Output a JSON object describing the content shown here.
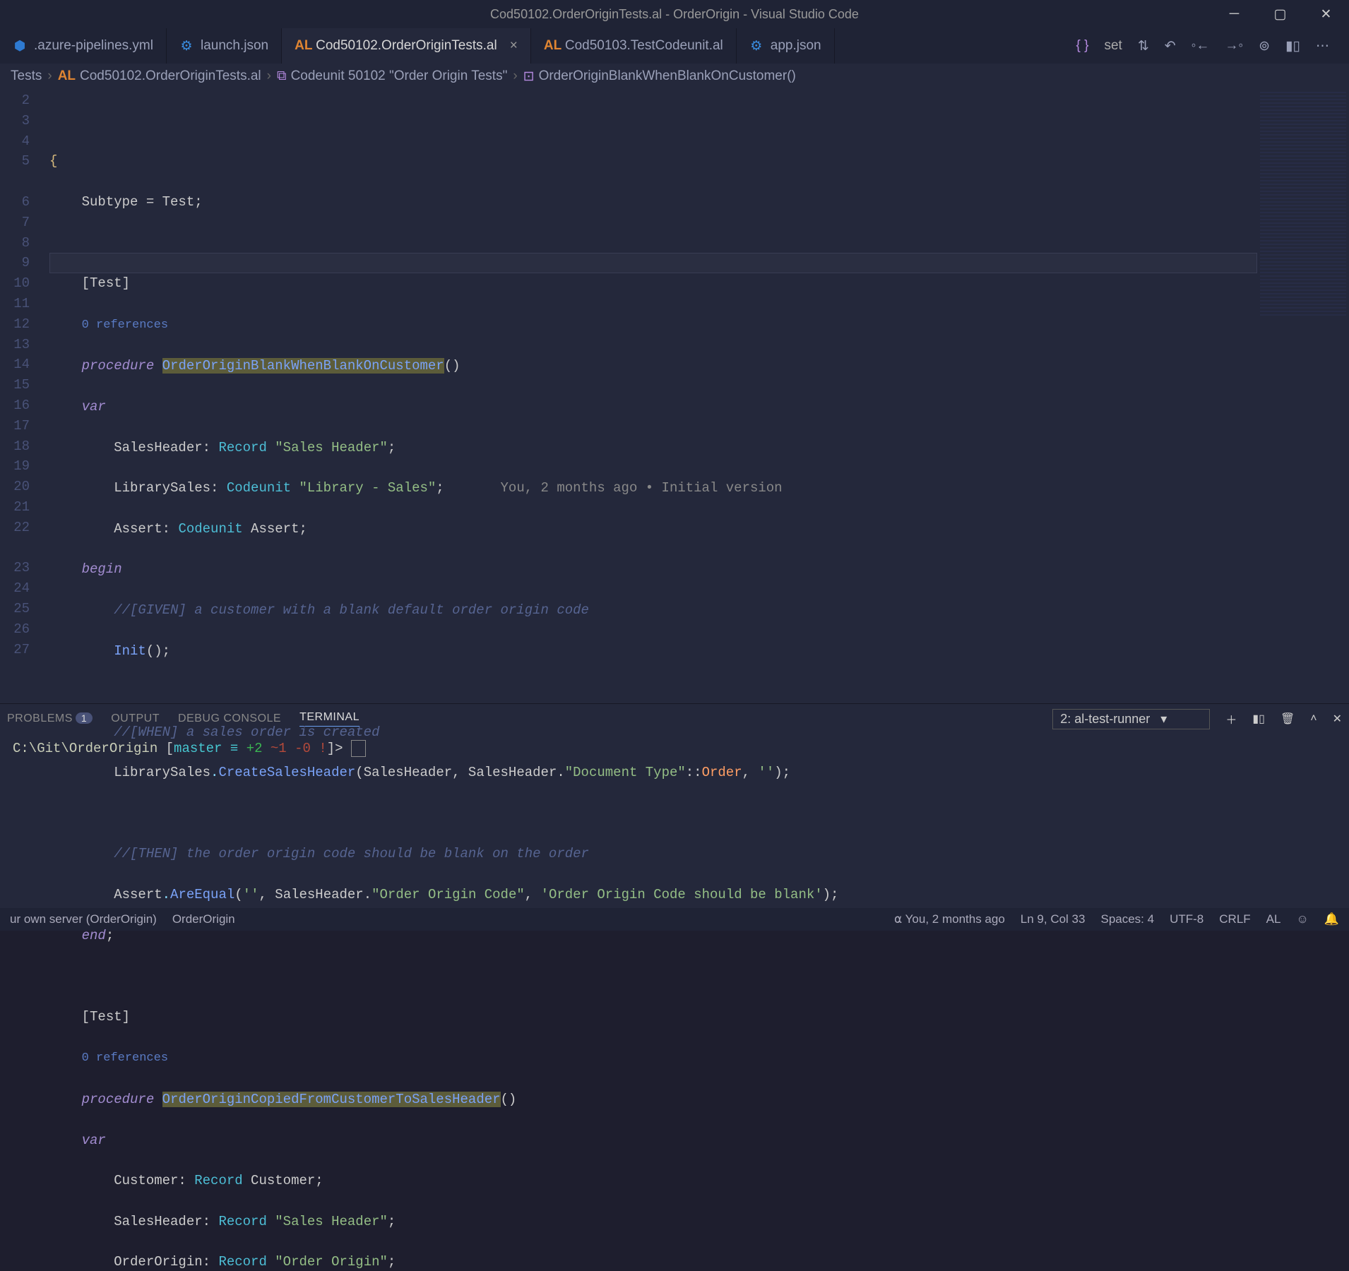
{
  "title": "Cod50102.OrderOriginTests.al - OrderOrigin - Visual Studio Code",
  "tabs": [
    {
      "icon": "⬢",
      "iconClass": "col-yml",
      "label": ".azure-pipelines.yml"
    },
    {
      "icon": "⚙",
      "iconClass": "col-vs",
      "label": "launch.json"
    },
    {
      "icon": "AL",
      "iconClass": "col-al",
      "label": "Cod50102.OrderOriginTests.al",
      "active": true,
      "close": true
    },
    {
      "icon": "AL",
      "iconClass": "col-al",
      "label": "Cod50103.TestCodeunit.al"
    },
    {
      "icon": "⚙",
      "iconClass": "col-vs",
      "label": "app.json"
    }
  ],
  "toolbar": {
    "set_label": "set"
  },
  "breadcrumbs": {
    "b0": "Tests",
    "b1": "Cod50102.OrderOriginTests.al",
    "b2": "Codeunit 50102 \"Order Origin Tests\"",
    "b3": "OrderOriginBlankWhenBlankOnCustomer()"
  },
  "line_start": 2,
  "line_end": 27,
  "currentLineIndex": 7,
  "references": {
    "r1": "0 references",
    "r2": "0 references"
  },
  "codelens": "You, 2 months ago • Initial version",
  "code": {
    "l3a": "Subtype = Test;",
    "l5a": "[Test]",
    "l6k": "procedure",
    "l6n": "OrderOriginBlankWhenBlankOnCustomer",
    "l7k": "var",
    "l8a": "SalesHeader: ",
    "l8t": "Record",
    "l8s": " \"Sales Header\"",
    "l8e": ";",
    "l9a": "LibrarySales: ",
    "l9t": "Codeunit",
    "l9s": " \"Library - Sales\"",
    "l9e": ";",
    "l10a": "Assert: ",
    "l10t": "Codeunit",
    "l10b": " Assert;",
    "l11k": "begin",
    "l12c": "//[GIVEN] a customer with a blank default order origin code",
    "l13a": "Init",
    "l13b": "();",
    "l15c": "//[WHEN] a sales order is created",
    "l16a": "LibrarySales",
    "l16b": "CreateSalesHeader",
    "l16c": "(SalesHeader, SalesHeader.",
    "l16s": "\"Document Type\"",
    "l16d": "::",
    "l16o": "Order",
    "l16e": ", ",
    "l16q": "''",
    "l16f": ");",
    "l18c": "//[THEN] the order origin code should be blank on the order",
    "l19a": "Assert",
    "l19b": "AreEqual",
    "l19c": "(",
    "l19q1": "''",
    "l19d": ", SalesHeader.",
    "l19s": "\"Order Origin Code\"",
    "l19e": ", ",
    "l19q2": "'Order Origin Code should be blank'",
    "l19f": ");",
    "l20k": "end",
    "l20e": ";",
    "l22a": "[Test]",
    "l23k": "procedure",
    "l23n": "OrderOriginCopiedFromCustomerToSalesHeader",
    "l24k": "var",
    "l25a": "Customer: ",
    "l25t": "Record",
    "l25b": " Customer;",
    "l26a": "SalesHeader: ",
    "l26t": "Record",
    "l26s": " \"Sales Header\"",
    "l26e": ";",
    "l27a": "OrderOrigin: ",
    "l27t": "Record",
    "l27s": " \"Order Origin\"",
    "l27e": ";"
  },
  "panel": {
    "tabs": {
      "problems": "PROBLEMS",
      "problems_count": "1",
      "output": "OUTPUT",
      "debug": "DEBUG CONSOLE",
      "terminal": "TERMINAL"
    },
    "term_select": "2: al-test-runner",
    "prompt_path": "C:\\Git\\OrderOrigin ",
    "prompt_branch": "master",
    "prompt_sym": " ≡ ",
    "prompt_stat": "+2 ~1 -0 !",
    "prompt_tail": "]> "
  },
  "status": {
    "left1": "ur own server (OrderOrigin)",
    "left2": "OrderOrigin",
    "blame": "You, 2 months ago",
    "lncol": "Ln 9, Col 33",
    "spaces": "Spaces: 4",
    "enc": "UTF-8",
    "eol": "CRLF",
    "lang": "AL"
  }
}
